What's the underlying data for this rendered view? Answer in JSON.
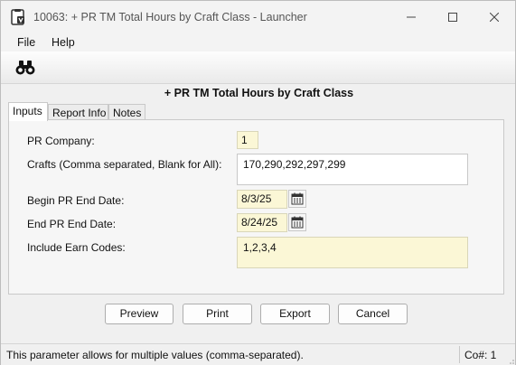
{
  "window": {
    "title": "10063: + PR TM Total Hours by Craft Class - Launcher",
    "controls": [
      "minimize-icon",
      "maximize-icon",
      "close-icon"
    ]
  },
  "menu": {
    "items": [
      "File",
      "Help"
    ]
  },
  "toolbar": {
    "icons": [
      "binoculars-icon"
    ]
  },
  "report": {
    "title": "+ PR TM Total Hours by Craft Class"
  },
  "tabs": [
    {
      "label": "Inputs",
      "active": true
    },
    {
      "label": "Report Info",
      "active": false
    },
    {
      "label": "Notes",
      "active": false
    }
  ],
  "inputs": {
    "pr_company": {
      "label": "PR Company:",
      "value": "1"
    },
    "crafts": {
      "label": "Crafts (Comma separated, Blank for All):",
      "value": "170,290,292,297,299"
    },
    "begin_date": {
      "label": "Begin PR End Date:",
      "value": "8/3/25"
    },
    "end_date": {
      "label": "End PR End Date:",
      "value": "8/24/25"
    },
    "earn_codes": {
      "label": "Include Earn Codes:",
      "value": "1,2,3,4"
    }
  },
  "buttons": {
    "preview": "Preview",
    "print": "Print",
    "export": "Export",
    "cancel": "Cancel"
  },
  "status": {
    "message": "This parameter allows for multiple values (comma-separated).",
    "company": "Co#: 1"
  },
  "colors": {
    "required_field": "#fbf7d6",
    "panel": "#f6f6f6",
    "window": "#f0f0f0"
  }
}
